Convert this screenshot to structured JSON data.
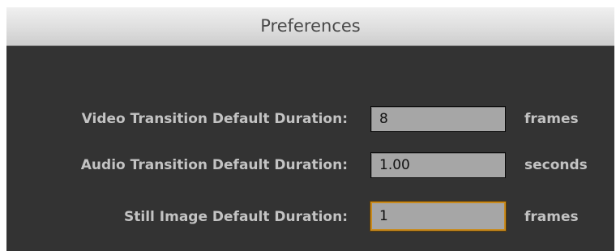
{
  "window": {
    "title": "Preferences"
  },
  "fields": [
    {
      "label": "Video Transition Default Duration:",
      "value": "8",
      "unit": "frames",
      "focused": false
    },
    {
      "label": "Audio Transition Default Duration:",
      "value": "1.00",
      "unit": "seconds",
      "focused": false
    },
    {
      "label": "Still Image Default Duration:",
      "value": "1",
      "unit": "frames",
      "focused": true
    }
  ]
}
